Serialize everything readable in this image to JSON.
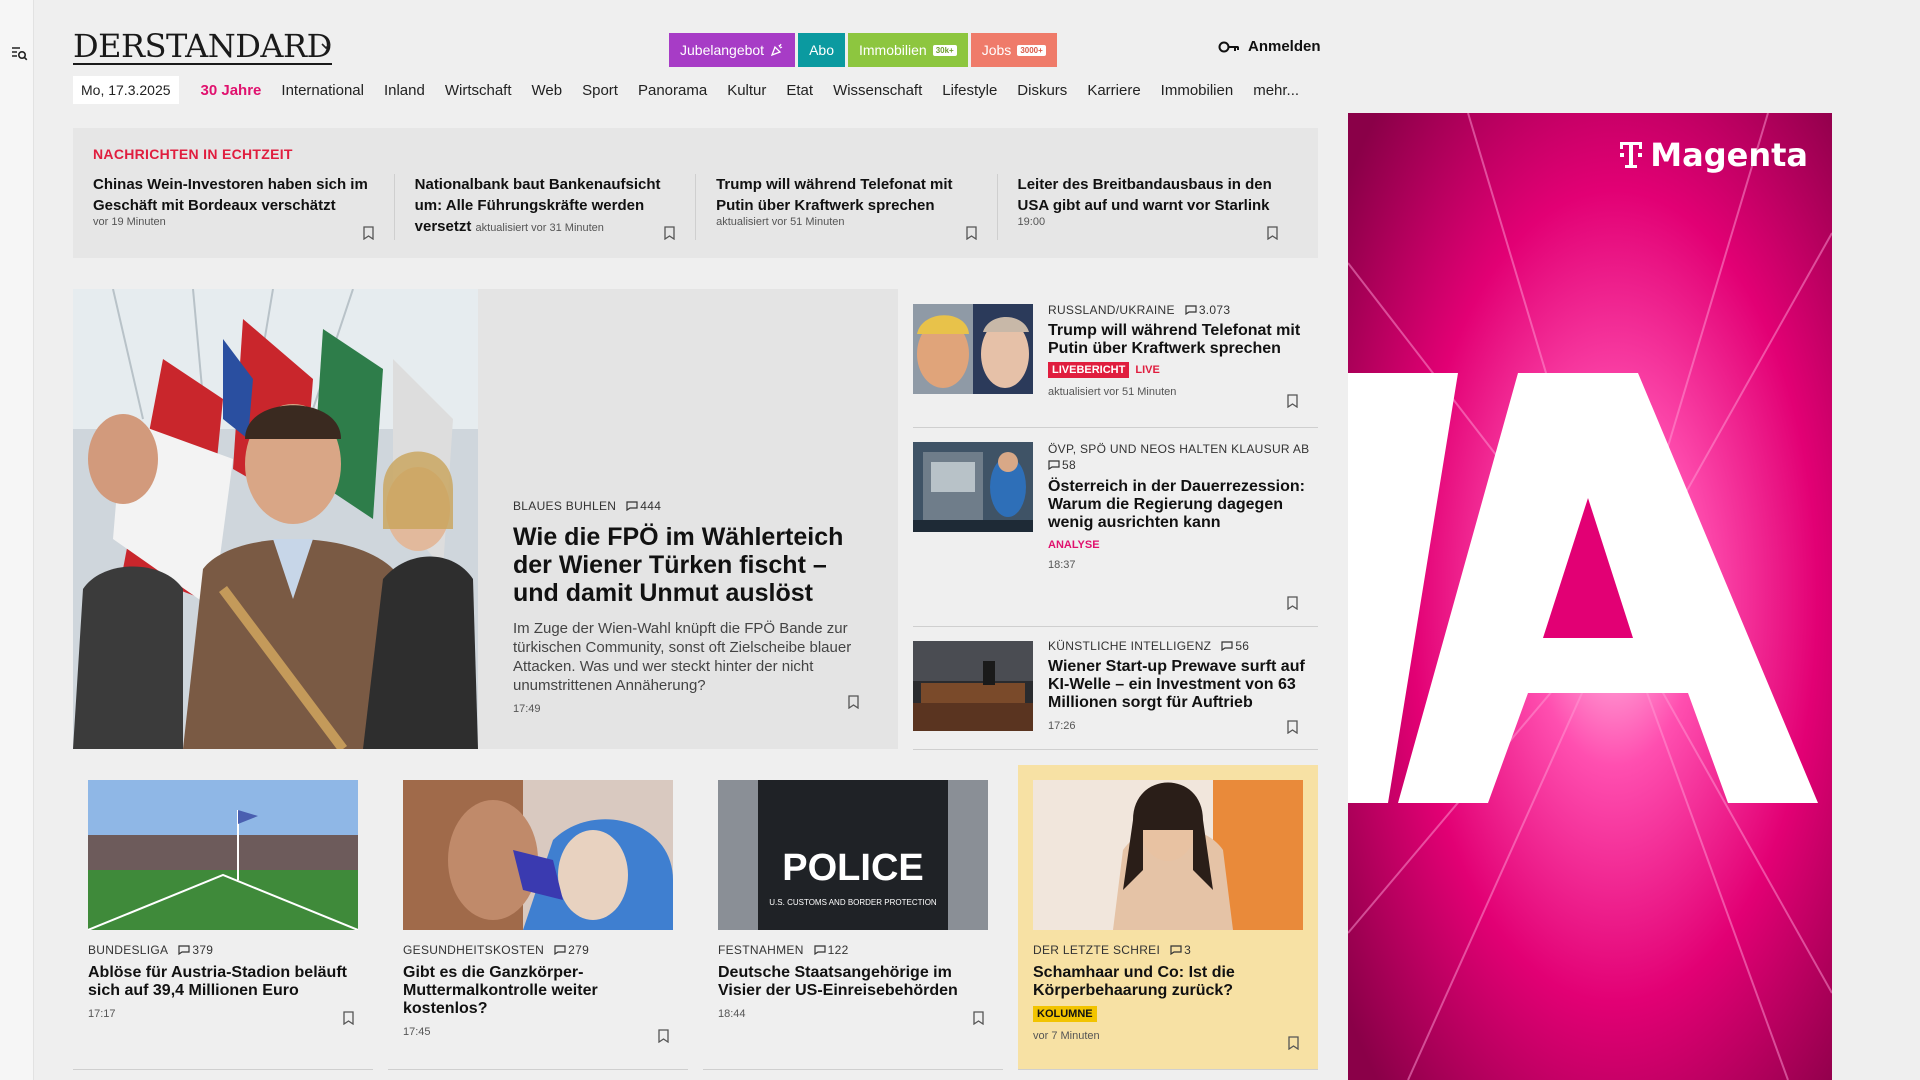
{
  "header": {
    "logo": "DERSTANDARD",
    "promo": [
      {
        "label": "Jubelangebot",
        "color": "#a73cc6",
        "icon": "party-icon"
      },
      {
        "label": "Abo",
        "color": "#0b9aa0"
      },
      {
        "label": "Immobilien",
        "color": "#8dc63f",
        "tag": "30k+"
      },
      {
        "label": "Jobs",
        "color": "#ef7b6a",
        "tag": "3000+"
      }
    ],
    "login": "Anmelden"
  },
  "nav": {
    "date": "Mo, 17.3.2025",
    "items": [
      "30 Jahre",
      "International",
      "Inland",
      "Wirtschaft",
      "Web",
      "Sport",
      "Panorama",
      "Kultur",
      "Etat",
      "Wissenschaft",
      "Lifestyle",
      "Diskurs",
      "Karriere",
      "Immobilien",
      "mehr..."
    ]
  },
  "ticker": {
    "heading": "NACHRICHTEN IN ECHTZEIT",
    "items": [
      {
        "title": "Chinas Wein-Investoren haben sich im Geschäft mit Bordeaux verschätzt",
        "time": "vor 19 Minuten"
      },
      {
        "title": "Nationalbank baut Bankenaufsicht um: Alle Führungskräfte werden versetzt",
        "time": "aktualisiert vor 31 Minuten"
      },
      {
        "title": "Trump will während Telefonat mit Putin über Kraftwerk sprechen",
        "time": "aktualisiert vor 51 Minuten"
      },
      {
        "title": "Leiter des Breitbandausbaus in den USA gibt auf und warnt vor Starlink",
        "time": "19:00"
      }
    ]
  },
  "lead": {
    "kicker": "BLAUES BUHLEN",
    "comments": "444",
    "title": "Wie die FPÖ im Wählerteich der Wiener Türken fischt – und damit Unmut auslöst",
    "teaser": "Im Zuge der Wien-Wahl knüpft die FPÖ Bande zur türkischen Community, sonst oft Zielscheibe blauer Attacken. Was und wer steckt hinter der nicht unumstrittenen Annäherung?",
    "time": "17:49"
  },
  "side": [
    {
      "kicker": "RUSSLAND/UKRAINE",
      "comments": "3.073",
      "title": "Trump will während Telefonat mit Putin über Kraftwerk sprechen",
      "badge": "LIVEBERICHT",
      "live": "LIVE",
      "time": "aktualisiert vor 51 Minuten"
    },
    {
      "kicker": "ÖVP, SPÖ UND NEOS HALTEN KLAUSUR AB",
      "comments": "58",
      "title": "Österreich in der Dauerrezession: Warum die Regierung dagegen wenig ausrichten kann",
      "label": "ANALYSE",
      "time": "18:37"
    },
    {
      "kicker": "KÜNSTLICHE INTELLIGENZ",
      "comments": "56",
      "title": "Wiener Start-up Prewave surft auf KI-Welle – ein Investment von 63 Millionen sorgt für Auftrieb",
      "time": "17:26"
    }
  ],
  "cards": [
    {
      "kicker": "BUNDESLIGA",
      "comments": "379",
      "title": "Ablöse für Austria-Stadion beläuft sich auf 39,4 Millionen Euro",
      "time": "17:17"
    },
    {
      "kicker": "GESUNDHEITSKOSTEN",
      "comments": "279",
      "title": "Gibt es die Ganzkörper-Muttermalkontrolle weiter kostenlos?",
      "time": "17:45"
    },
    {
      "kicker": "FESTNAHMEN",
      "comments": "122",
      "title": "Deutsche Staatsangehörige im Visier der US-Einreisebehörden",
      "time": "18:44",
      "img_text": "POLICE",
      "img_sub": "U.S. CUSTOMS AND BORDER PROTECTION"
    },
    {
      "kicker": "DER LETZTE SCHREI",
      "comments": "3",
      "title": "Schamhaar und Co: Ist die Körperbehaarung zurück?",
      "label": "KOLUMNE",
      "time": "vor 7 Minuten"
    }
  ],
  "ad": {
    "brand": "Magenta",
    "letter": "A",
    "colors": {
      "magenta": "#e20074"
    }
  }
}
